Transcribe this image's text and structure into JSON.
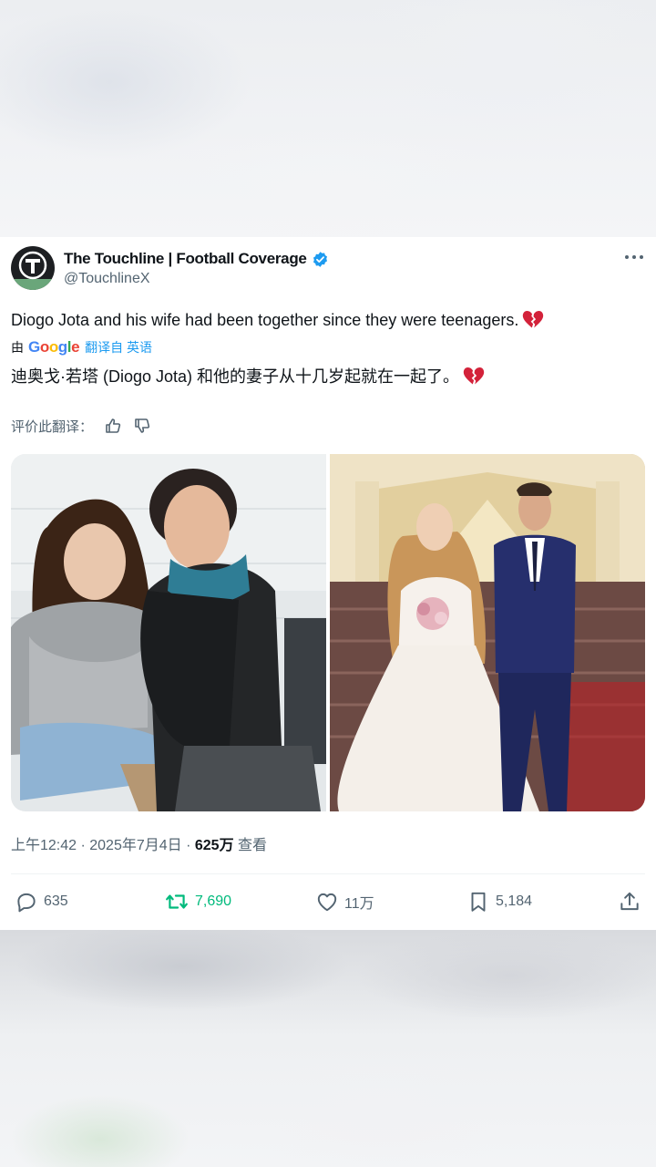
{
  "tweet": {
    "display_name": "The Touchline | Football Coverage",
    "handle": "@TouchlineX",
    "avatar_letter": "T",
    "text": "Diogo Jota and his wife had been together since they were teenagers.",
    "emoji": "broken-heart",
    "translation": {
      "by_label": "由",
      "provider": "Google",
      "action_label": "翻译自 英语",
      "text": "迪奥戈·若塔 (Diogo Jota) 和他的妻子从十几岁起就在一起了。"
    },
    "rate_label": "评价此翻译：",
    "timestamp": "上午12:42 · 2025年7月4日 · ",
    "views_count": "625万",
    "views_label": " 查看",
    "actions": {
      "replies": "635",
      "retweets": "7,690",
      "likes": "11万",
      "bookmarks": "5,184"
    }
  },
  "colors": {
    "accent": "#1d9bf0",
    "retweet_green": "#00ba7c",
    "text_primary": "#0f1419",
    "text_secondary": "#536471",
    "heart_red": "#d3223a"
  },
  "icons": {
    "verified": "verified-badge-icon",
    "more": "more-dots-icon",
    "thumbs_up": "thumbs-up-icon",
    "thumbs_down": "thumbs-down-icon",
    "reply": "reply-icon",
    "retweet": "retweet-icon",
    "like": "heart-icon",
    "bookmark": "bookmark-icon",
    "share": "share-icon"
  }
}
